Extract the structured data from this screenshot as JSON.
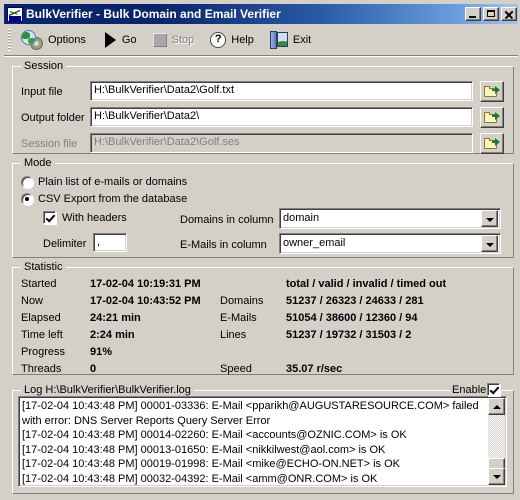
{
  "window": {
    "title": "BulkVerifier - Bulk Domain and Email Verifier",
    "icon": "app-icon",
    "minimize_label": "",
    "maximize_label": "",
    "close_label": ""
  },
  "toolbar": {
    "items": [
      {
        "label": "Options",
        "icon": "options-globe-gear-icon",
        "enabled": true
      },
      {
        "label": "Go",
        "icon": "play-triangle-icon",
        "enabled": true
      },
      {
        "label": "Stop",
        "icon": "stop-square-icon",
        "enabled": false
      },
      {
        "label": "Help",
        "icon": "question-mark-icon",
        "enabled": true
      },
      {
        "label": "Exit",
        "icon": "open-door-icon",
        "enabled": true
      }
    ]
  },
  "session": {
    "title": "Session",
    "input_file": {
      "label": "Input file",
      "value": "H:\\BulkVerifier\\Data2\\Golf.txt",
      "readonly": false
    },
    "output_folder": {
      "label": "Output folder",
      "value": "H:\\BulkVerifier\\Data2\\",
      "readonly": false
    },
    "session_file": {
      "label": "Session file",
      "value": "H:\\BulkVerifier\\Data2\\Golf.ses",
      "readonly": true
    },
    "browse_label": "Browse"
  },
  "mode": {
    "title": "Mode",
    "options": [
      {
        "label": "Plain list of e-mails or domains",
        "selected": false
      },
      {
        "label": "CSV Export from the database",
        "selected": true
      }
    ],
    "with_headers": {
      "label": "With headers",
      "checked": true
    },
    "delimiter": {
      "label": "Delimiter",
      "value": ","
    },
    "domains_in_column": {
      "label": "Domains in column",
      "value": "domain"
    },
    "emails_in_column": {
      "label": "E-Mails in column",
      "value": "owner_email"
    }
  },
  "statistic": {
    "title": "Statistic",
    "rows": [
      {
        "label": "Started",
        "value": "17-02-04 10:19:31 PM"
      },
      {
        "label": "Now",
        "value": "17-02-04 10:43:52 PM"
      },
      {
        "label": "Elapsed",
        "value": "24:21 min"
      },
      {
        "label": "Time left",
        "value": "2:24 min"
      },
      {
        "label": "Progress",
        "value": "91%"
      },
      {
        "label": "Threads",
        "value": "0"
      }
    ],
    "counters_header": "total / valid / invalid / timed out",
    "counters": [
      {
        "label": "Domains",
        "value": "51237 / 26323 / 24633 / 281"
      },
      {
        "label": "E-Mails",
        "value": "51054 / 38600 / 12360 / 94"
      },
      {
        "label": "Lines",
        "value": "51237 / 19732 / 31503 / 2"
      }
    ],
    "speed": {
      "label": "Speed",
      "value": "35.07 r/sec"
    }
  },
  "log": {
    "title": "Log H:\\BulkVerifier\\BulkVerifier.log",
    "enable": {
      "label": "Enable",
      "checked": true
    },
    "lines": [
      "[17-02-04 10:43:48 PM] 00001-03336: E-Mail <pparikh@AUGUSTARESOURCE.COM> failed with error: DNS Server Reports Query Server Error",
      "[17-02-04 10:43:48 PM] 00014-02260: E-Mail <accounts@OZNIC.COM> is OK",
      "[17-02-04 10:43:48 PM] 00013-01650: E-Mail <nikkilwest@aol.com> is OK",
      "[17-02-04 10:43:48 PM] 00019-01998: E-Mail <mike@ECHO-ON.NET> is OK",
      "[17-02-04 10:43:48 PM] 00032-04392: E-Mail <amm@ONR.COM> is OK"
    ]
  },
  "colors": {
    "title_bar_start": "#0a246a",
    "title_bar_end": "#a6c8ec",
    "face": "#d4d0c8",
    "field_bg": "#ffffff",
    "disabled_text": "#808080"
  }
}
